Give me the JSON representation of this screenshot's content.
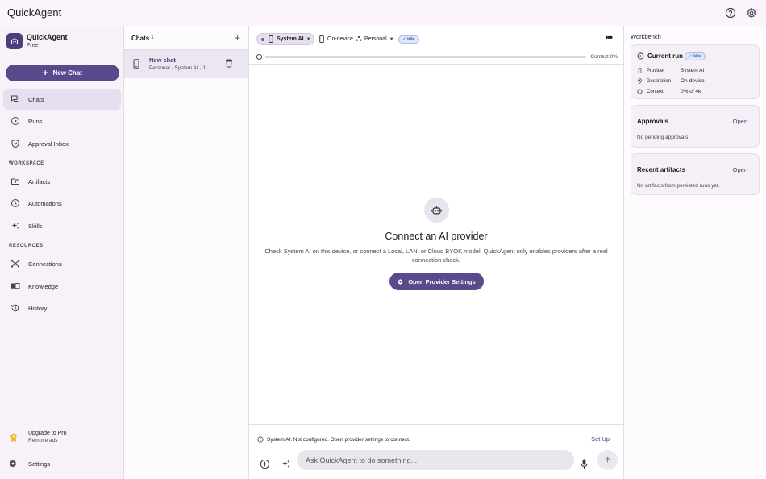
{
  "app": {
    "title": "QuickAgent"
  },
  "brand": {
    "name": "QuickAgent",
    "plan": "Free"
  },
  "sidebar": {
    "new_chat_label": "New Chat",
    "items": [
      {
        "label": "Chats",
        "icon": "chat-icon",
        "active": true
      },
      {
        "label": "Runs",
        "icon": "play-circle-icon"
      },
      {
        "label": "Approval Inbox",
        "icon": "shield-check-icon"
      }
    ],
    "workspace_label": "WORKSPACE",
    "workspace_items": [
      {
        "label": "Artifacts",
        "icon": "folder-icon"
      },
      {
        "label": "Automations",
        "icon": "clock-icon"
      },
      {
        "label": "Skills",
        "icon": "sparkle-icon"
      }
    ],
    "resources_label": "RESOURCES",
    "resources_items": [
      {
        "label": "Connections",
        "icon": "hub-icon"
      },
      {
        "label": "Knowledge",
        "icon": "book-icon"
      },
      {
        "label": "History",
        "icon": "history-icon"
      }
    ],
    "upgrade": {
      "title": "Upgrade to Pro",
      "subtitle": "Remove ads"
    },
    "settings_label": "Settings"
  },
  "chatlist": {
    "title": "Chats",
    "count": "1",
    "chats": [
      {
        "name": "New chat",
        "meta": "Personal · System AI · 1..."
      }
    ]
  },
  "toolbar": {
    "provider": "System AI",
    "destination": "On-device",
    "profile": "Personal",
    "status": "Idle",
    "context_label": "Context 0%",
    "context_fraction": 0
  },
  "empty": {
    "title": "Connect an AI provider",
    "body": "Check System AI on this device, or connect a Local, LAN, or Cloud BYOK model. QuickAgent only enables providers after a real connection check.",
    "button": "Open Provider Settings"
  },
  "status": {
    "message": "System AI: Not configured. Open provider settings to connect.",
    "action": "Set Up"
  },
  "composer": {
    "placeholder": "Ask QuickAgent to do something..."
  },
  "workbench": {
    "title": "Workbench",
    "current_run": {
      "title": "Current run",
      "status": "Idle",
      "rows": [
        {
          "key": "Provider",
          "value": "System AI"
        },
        {
          "key": "Destination",
          "value": "On-device"
        },
        {
          "key": "Context",
          "value": "0% of 4k"
        }
      ]
    },
    "approvals": {
      "title": "Approvals",
      "open": "Open",
      "body": "No pending approvals."
    },
    "artifacts": {
      "title": "Recent artifacts",
      "open": "Open",
      "body": "No artifacts from persisted runs yet."
    }
  },
  "colors": {
    "accent": "#5b4a8b",
    "active_bg": "#e6dff2",
    "idle_badge": "#dde6fb"
  }
}
